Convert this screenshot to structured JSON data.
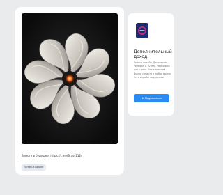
{
  "post": {
    "text": "Вместе в будущее: https://t.me/Brass1124",
    "button_label": "Читать в канале"
  },
  "ad": {
    "title": "Дополнительный доход.",
    "description": "Работа онлайн. Достаточно телефон и 10 мин. несколько раз в день. Без вложений. Выход средств в любое время. Есть служба поддержки.",
    "button_icon": "send-icon",
    "button_label": "Подписаться"
  },
  "colors": {
    "page_bg": "#e9ebed",
    "accent": "#2a8bf2",
    "image_bg": "#0e0e10"
  }
}
